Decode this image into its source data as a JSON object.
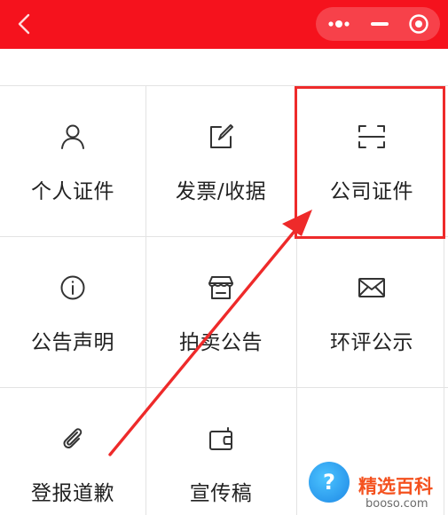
{
  "top_bar": {
    "background": "#f5121d",
    "back_icon": "chevron-left-icon",
    "capsule_icons": [
      "more-dots-icon",
      "minimize-icon",
      "close-target-icon"
    ]
  },
  "grid": {
    "items": [
      {
        "label": "个人证件",
        "icon": "person-icon"
      },
      {
        "label": "发票/收据",
        "icon": "edit-square-icon"
      },
      {
        "label": "公司证件",
        "icon": "scan-icon"
      },
      {
        "label": "公告声明",
        "icon": "info-circle-icon"
      },
      {
        "label": "拍卖公告",
        "icon": "store-icon"
      },
      {
        "label": "环评公示",
        "icon": "mail-icon"
      },
      {
        "label": "登报道歉",
        "icon": "paperclip-icon"
      },
      {
        "label": "宣传稿",
        "icon": "wallet-icon"
      },
      {
        "label": "",
        "icon": ""
      }
    ]
  },
  "annotation": {
    "highlighted_item": "公司证件",
    "color": "#ee2a2a"
  },
  "watermark": {
    "badge": "?",
    "logo": "精选百科",
    "url": "booso.com"
  }
}
